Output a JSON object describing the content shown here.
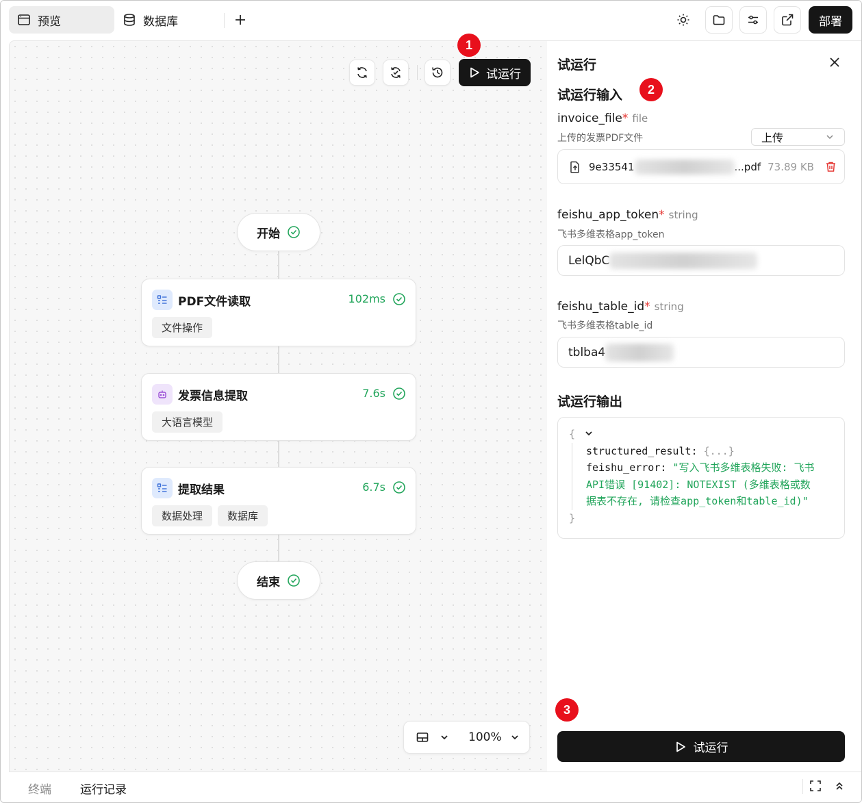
{
  "topbar": {
    "tabs": [
      {
        "label": "预览",
        "icon": "browser-window-icon",
        "active": true
      },
      {
        "label": "数据库",
        "icon": "database-icon",
        "active": false
      }
    ],
    "add_tab_icon": "plus-icon",
    "actions": [
      "sun-icon",
      "folder-icon",
      "sliders-icon",
      "external-link-icon"
    ],
    "deploy_label": "部署"
  },
  "canvas": {
    "toolbar_icons": [
      "refresh-icon",
      "sync-icon",
      "history-icon"
    ],
    "run_label": "试运行",
    "badge_1": "1",
    "start_label": "开始",
    "end_label": "结束",
    "nodes": [
      {
        "title": "PDF文件读取",
        "time": "102ms",
        "icon": "list-icon",
        "tags": [
          "文件操作"
        ]
      },
      {
        "title": "发票信息提取",
        "time": "7.6s",
        "icon": "robot-icon",
        "tags": [
          "大语言模型"
        ]
      },
      {
        "title": "提取结果",
        "time": "6.7s",
        "icon": "list-icon",
        "tags": [
          "数据处理",
          "数据库"
        ]
      }
    ],
    "zoom": "100%",
    "layout_icon": "layout-icon"
  },
  "panel": {
    "title": "试运行",
    "close_icon": "close-icon",
    "input_section": "试运行输入",
    "badge_2": "2",
    "fields": [
      {
        "name": "invoice_file",
        "type": "file",
        "required_mark": "*",
        "desc": "上传的发票PDF文件"
      },
      {
        "name": "feishu_app_token",
        "type": "string",
        "required_mark": "*",
        "desc": "飞书多维表格app_token",
        "value": "LelQbC"
      },
      {
        "name": "feishu_table_id",
        "type": "string",
        "required_mark": "*",
        "desc": "飞书多维表格table_id",
        "value": "tblba4"
      }
    ],
    "upload_select": "上传",
    "file": {
      "name_start": "9e33541",
      "name_end": "...pdf",
      "size": "73.89 KB"
    },
    "output_section": "试运行输出",
    "output": {
      "open_brace": "{",
      "close_brace": "}",
      "key1": "structured_result:",
      "val1": "{...}",
      "key2": "feishu_error:",
      "val2_line1": "\"写入飞书多维表格失败: 飞书",
      "val2_line2": "API错误 [91402]: NOTEXIST (多维表格或数",
      "val2_line3": "据表不存在, 请检查app_token和table_id)\""
    },
    "badge_3": "3",
    "run_label": "试运行"
  },
  "bottombar": {
    "tabs": [
      {
        "label": "终端",
        "active": false
      },
      {
        "label": "运行记录",
        "active": true
      }
    ],
    "icons": [
      "fullscreen-icon",
      "chevrons-up-icon"
    ]
  },
  "colors": {
    "accent_dark": "#161616",
    "success_green": "#22a55b",
    "badge_red": "#e8101c",
    "required_red": "#e53935"
  }
}
